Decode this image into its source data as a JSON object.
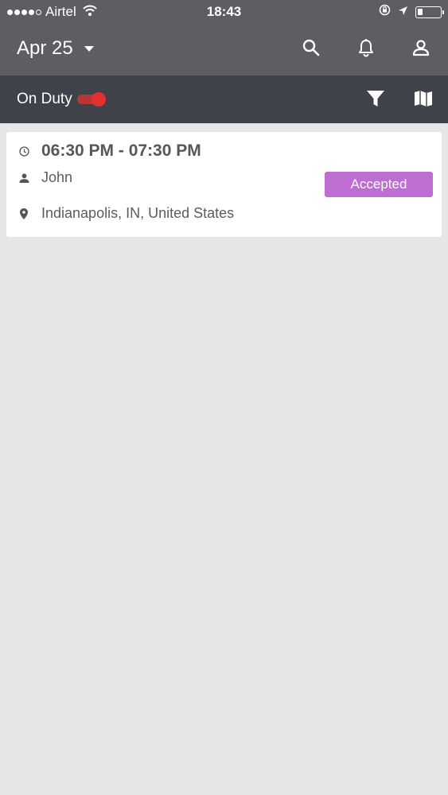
{
  "status_bar": {
    "carrier": "Airtel",
    "time": "18:43",
    "signal_bars_filled": 4,
    "signal_bars_total": 5
  },
  "header": {
    "date": "Apr 25",
    "icons": [
      "search-icon",
      "bell-icon",
      "user-icon"
    ]
  },
  "duty": {
    "label": "On Duty",
    "on": true,
    "toggle_color": "#e33131",
    "icons": [
      "filter-icon",
      "map-icon"
    ]
  },
  "appointments": [
    {
      "time_range": "06:30 PM - 07:30 PM",
      "name": "John",
      "location": "Indianapolis, IN, United States",
      "status": "Accepted",
      "status_color": "#be6dd2"
    }
  ],
  "colors": {
    "header_bg": "#5d5e61",
    "duty_bar_bg": "#3f4248",
    "background": "#e5e6e8"
  }
}
